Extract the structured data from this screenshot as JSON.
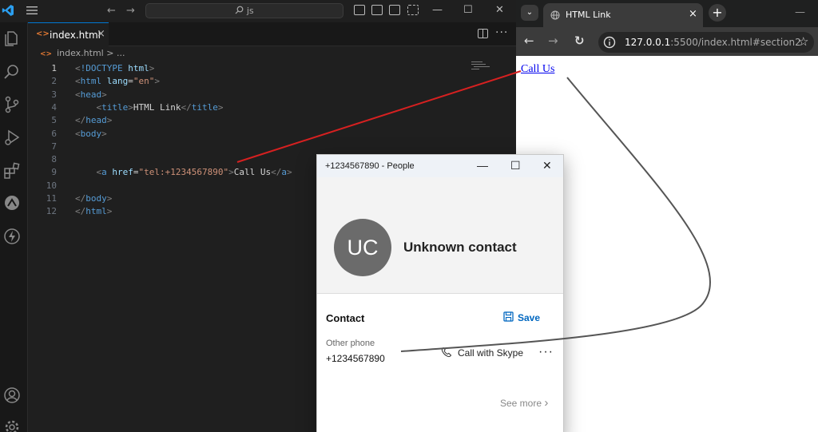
{
  "vscode": {
    "search_text": "js",
    "tab_tag": "<>",
    "tab_name": "index.html",
    "close_glyph": "×",
    "breadcrumb_tag": "<>",
    "breadcrumb": "index.html > ...",
    "minimize": "—",
    "maximize": "☐",
    "close": "✕",
    "more": "···",
    "back": "←",
    "forward": "→",
    "activity_icons": [
      "explorer-icon",
      "search-icon",
      "source-control-icon",
      "run-debug-icon",
      "extensions-icon",
      "remote-icon",
      "lightning-icon",
      "account-icon",
      "settings-gear-icon"
    ],
    "accent": "#0078d4"
  },
  "code_lines": [
    {
      "n": "1",
      "parts": [
        [
          "t-br",
          "<"
        ],
        [
          "t-tag",
          "!DOCTYPE "
        ],
        [
          "t-attr",
          "html"
        ],
        [
          "t-br",
          ">"
        ]
      ]
    },
    {
      "n": "2",
      "parts": [
        [
          "t-br",
          "<"
        ],
        [
          "t-tag",
          "html "
        ],
        [
          "t-attr",
          "lang"
        ],
        [
          "t-txt",
          "="
        ],
        [
          "t-str",
          "\"en\""
        ],
        [
          "t-br",
          ">"
        ]
      ]
    },
    {
      "n": "3",
      "parts": [
        [
          "t-br",
          "<"
        ],
        [
          "t-tag",
          "head"
        ],
        [
          "t-br",
          ">"
        ]
      ]
    },
    {
      "n": "4",
      "parts": [
        [
          "t-txt",
          "    "
        ],
        [
          "t-br",
          "<"
        ],
        [
          "t-tag",
          "title"
        ],
        [
          "t-br",
          ">"
        ],
        [
          "t-txt",
          "HTML Link"
        ],
        [
          "t-br",
          "</"
        ],
        [
          "t-tag",
          "title"
        ],
        [
          "t-br",
          ">"
        ]
      ]
    },
    {
      "n": "5",
      "parts": [
        [
          "t-br",
          "</"
        ],
        [
          "t-tag",
          "head"
        ],
        [
          "t-br",
          ">"
        ]
      ]
    },
    {
      "n": "6",
      "parts": [
        [
          "t-br",
          "<"
        ],
        [
          "t-tag",
          "body"
        ],
        [
          "t-br",
          ">"
        ]
      ]
    },
    {
      "n": "7",
      "parts": []
    },
    {
      "n": "8",
      "parts": []
    },
    {
      "n": "9",
      "parts": [
        [
          "t-txt",
          "    "
        ],
        [
          "t-br",
          "<"
        ],
        [
          "t-tag",
          "a "
        ],
        [
          "t-attr",
          "href"
        ],
        [
          "t-txt",
          "="
        ],
        [
          "t-str",
          "\"tel:+1234567890\""
        ],
        [
          "t-br",
          ">"
        ],
        [
          "t-txt",
          "Call Us"
        ],
        [
          "t-br",
          "</"
        ],
        [
          "t-tag",
          "a"
        ],
        [
          "t-br",
          ">"
        ]
      ]
    },
    {
      "n": "10",
      "parts": []
    },
    {
      "n": "11",
      "parts": [
        [
          "t-br",
          "</"
        ],
        [
          "t-tag",
          "body"
        ],
        [
          "t-br",
          ">"
        ]
      ]
    },
    {
      "n": "12",
      "parts": [
        [
          "t-br",
          "</"
        ],
        [
          "t-tag",
          "html"
        ],
        [
          "t-br",
          ">"
        ]
      ]
    }
  ],
  "browser": {
    "tab_title": "HTML Link",
    "tabs_button": "⌄",
    "close_glyph": "×",
    "new_tab": "+",
    "minimize": "—",
    "back": "←",
    "forward": "→",
    "reload": "↻",
    "url_host": "127.0.0.1",
    "url_rest": ":5500/index.html#section2",
    "star": "☆",
    "link_text": "Call Us"
  },
  "people": {
    "title": "+1234567890 - People",
    "minimize": "—",
    "maximize": "☐",
    "close": "✕",
    "initials": "UC",
    "contact_name": "Unknown contact",
    "section_title": "Contact",
    "save_label": "Save",
    "phone_label": "Other phone",
    "phone_number": "+1234567890",
    "call_label": "Call with Skype",
    "more": "···",
    "see_more": "See more",
    "chevron": "›",
    "accent": "#0067c0"
  }
}
